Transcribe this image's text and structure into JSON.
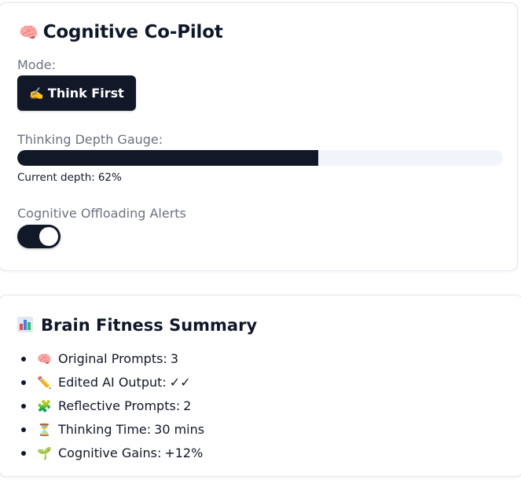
{
  "copilot": {
    "emoji": "🧠",
    "title": "Cognitive Co-Pilot",
    "mode_label": "Mode:",
    "mode_button": {
      "emoji": "✍️",
      "label": "Think First"
    },
    "gauge_label": "Thinking Depth Gauge:",
    "gauge_value_percent": 62,
    "depth_text_prefix": "Current depth:",
    "depth_text_value": "62%",
    "alerts_label": "Cognitive Offloading Alerts",
    "alerts_enabled": true
  },
  "summary": {
    "icon": "bar-chart-icon",
    "title": "Brain Fitness Summary",
    "items": [
      {
        "emoji": "🧠",
        "label": "Original Prompts:",
        "value": "3"
      },
      {
        "emoji": "✏️",
        "label": "Edited AI Output:",
        "value": "✓✓"
      },
      {
        "emoji": "🧩",
        "label": "Reflective Prompts:",
        "value": "2"
      },
      {
        "emoji": "⏳",
        "label": "Thinking Time:",
        "value": "30 mins"
      },
      {
        "emoji": "🌱",
        "label": "Cognitive Gains:",
        "value": "+12%"
      }
    ]
  },
  "colors": {
    "primary": "#111827",
    "muted_label": "#6b7280",
    "track": "#f1f5f9",
    "card_border": "#e5e7eb"
  }
}
